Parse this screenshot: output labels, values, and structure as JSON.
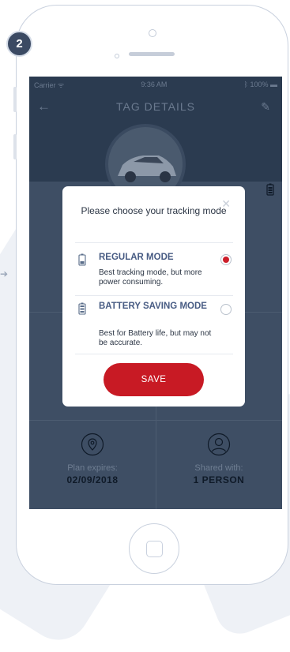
{
  "step_badge": "2",
  "status_bar": {
    "carrier": "Carrier",
    "time": "9:36 AM",
    "battery": "100%"
  },
  "nav": {
    "title": "TAG DETAILS"
  },
  "dialog": {
    "title": "Please choose your tracking mode",
    "options": [
      {
        "title": "REGULAR MODE",
        "description": "Best tracking mode, but more power consuming.",
        "selected": true
      },
      {
        "title": "BATTERY SAVING MODE",
        "description": "Best for Battery life, but may not be accurate.",
        "selected": false
      }
    ],
    "save_label": "SAVE"
  },
  "info_cards": [
    {
      "label": "Plan expires:",
      "value": "02/09/2018",
      "icon": "location-pin-icon"
    },
    {
      "label": "Shared with:",
      "value": "1 PERSON",
      "icon": "user-icon"
    }
  ],
  "colors": {
    "accent": "#c81a24",
    "screen_bg": "#2b3b50",
    "badge": "#3b4a63",
    "option_title": "#475b83"
  }
}
